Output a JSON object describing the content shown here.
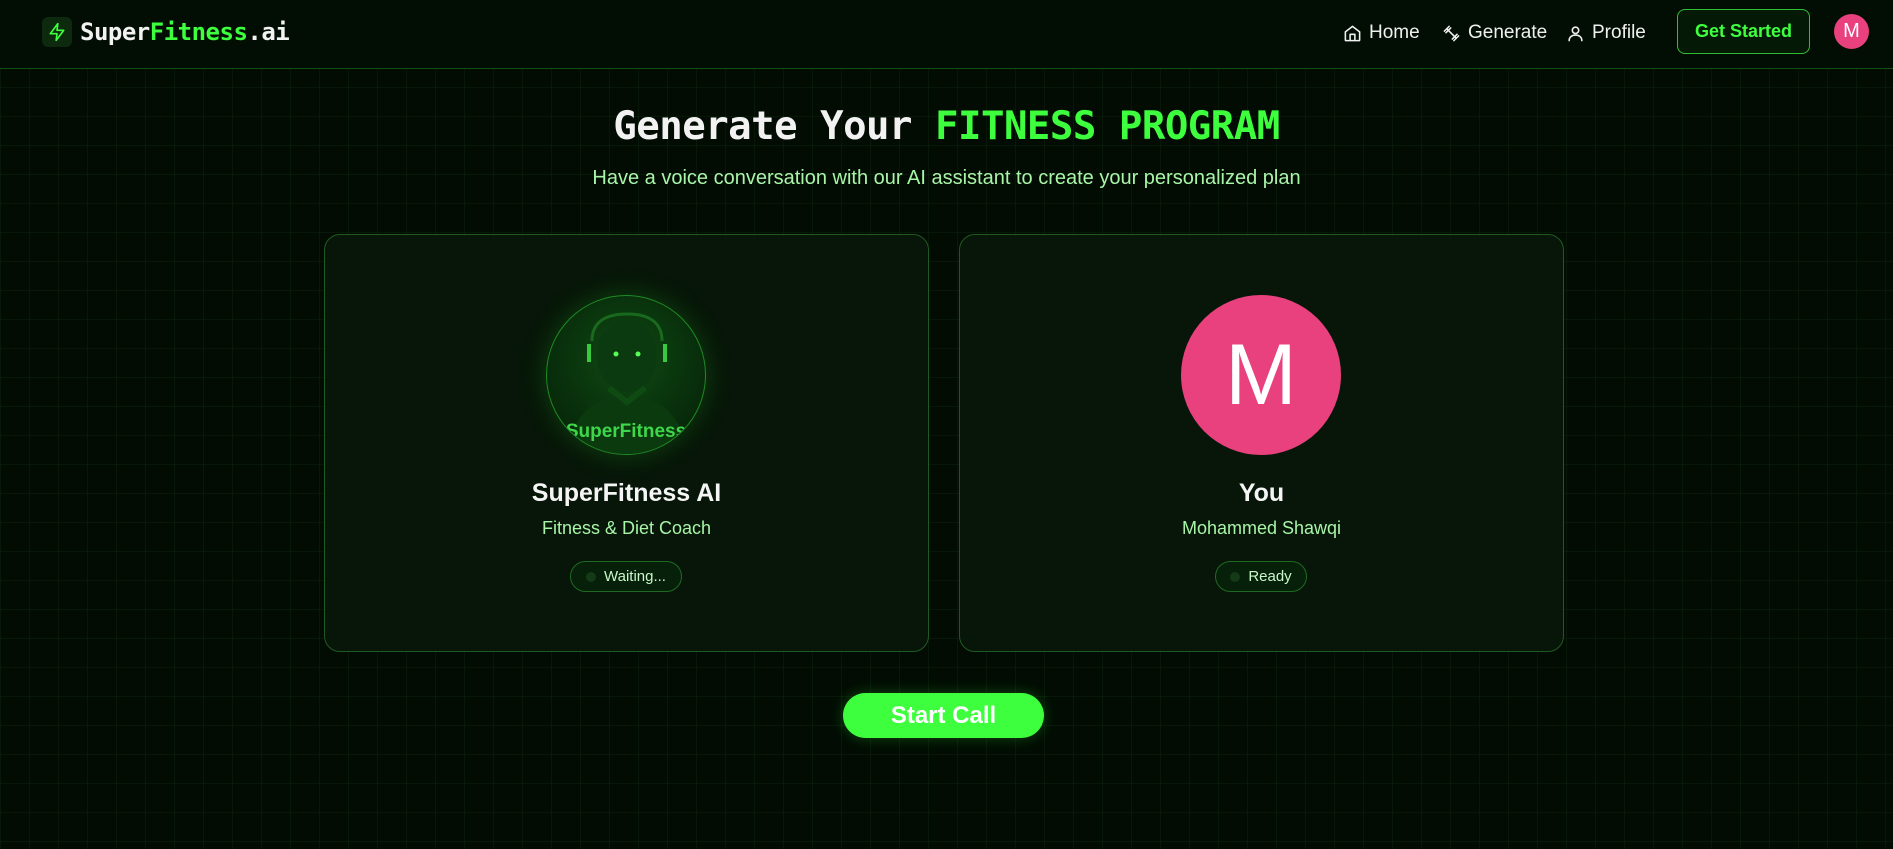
{
  "navbar": {
    "logo_part1": "Super",
    "logo_part2": "Fitness",
    "logo_part3": ".ai",
    "logo_icon": "lightning-bolt-icon",
    "links": [
      {
        "label": "Home",
        "icon": "home-icon"
      },
      {
        "label": "Generate",
        "icon": "dumbbell-icon"
      },
      {
        "label": "Profile",
        "icon": "user-icon"
      }
    ],
    "cta_label": "Get Started",
    "avatar_letter": "M"
  },
  "hero": {
    "title_prefix": "Generate Your ",
    "title_accent": "FITNESS PROGRAM",
    "subtitle": "Have a voice conversation with our AI assistant to create your personalized plan"
  },
  "ai_card": {
    "avatar_label": "SuperFitness",
    "name": "SuperFitness AI",
    "role": "Fitness & Diet Coach",
    "status": "Waiting..."
  },
  "user_card": {
    "avatar_letter": "M",
    "name": "You",
    "full_name": "Mohammed Shawqi",
    "status": "Ready"
  },
  "actions": {
    "start_call_label": "Start Call"
  },
  "colors": {
    "accent": "#3dff3d",
    "background": "#020c03",
    "avatar_pink": "#e8417e"
  }
}
